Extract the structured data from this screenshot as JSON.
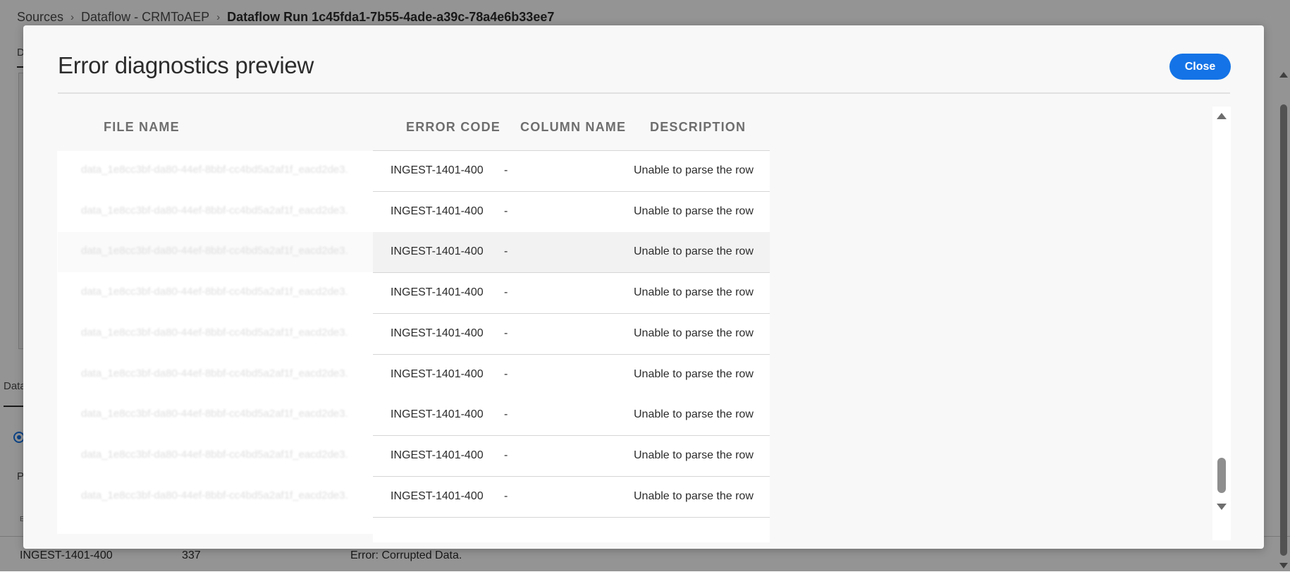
{
  "breadcrumb": {
    "items": [
      "Sources",
      "Dataflow - CRMToAEP"
    ],
    "current": "Dataflow Run 1c45fda1-7b55-4ade-a39c-78a4e6b33ee7",
    "separator": "›"
  },
  "background": {
    "tab_top": "D",
    "tab_bottom": "Data",
    "p_label": "P",
    "e_label": "E",
    "footer": {
      "error_code": "INGEST-1401-400",
      "count": "337",
      "description": "Error: Corrupted Data."
    }
  },
  "modal": {
    "title": "Error diagnostics preview",
    "close_label": "Close",
    "columns": {
      "file_name": "FILE NAME",
      "error_code": "ERROR CODE",
      "column_name": "COLUMN NAME",
      "description": "DESCRIPTION"
    },
    "rows": [
      {
        "file": "data_1e8cc3bf-da80-44ef-8bbf-cc4bd5a2af1f_eacd2de3...",
        "code": "INGEST-1401-400",
        "column": "-",
        "description": "Unable to parse the row"
      },
      {
        "file": "data_1e8cc3bf-da80-44ef-8bbf-cc4bd5a2af1f_eacd2de3...",
        "code": "INGEST-1401-400",
        "column": "-",
        "description": "Unable to parse the row"
      },
      {
        "file": "data_1e8cc3bf-da80-44ef-8bbf-cc4bd5a2af1f_eacd2de3...",
        "code": "INGEST-1401-400",
        "column": "-",
        "description": "Unable to parse the row"
      },
      {
        "file": "data_1e8cc3bf-da80-44ef-8bbf-cc4bd5a2af1f_eacd2de3...",
        "code": "INGEST-1401-400",
        "column": "-",
        "description": "Unable to parse the row"
      },
      {
        "file": "data_1e8cc3bf-da80-44ef-8bbf-cc4bd5a2af1f_eacd2de3...",
        "code": "INGEST-1401-400",
        "column": "-",
        "description": "Unable to parse the row"
      },
      {
        "file": "data_1e8cc3bf-da80-44ef-8bbf-cc4bd5a2af1f_eacd2de3...",
        "code": "INGEST-1401-400",
        "column": "-",
        "description": "Unable to parse the row"
      },
      {
        "file": "data_1e8cc3bf-da80-44ef-8bbf-cc4bd5a2af1f_eacd2de3...",
        "code": "INGEST-1401-400",
        "column": "-",
        "description": "Unable to parse the row"
      },
      {
        "file": "data_1e8cc3bf-da80-44ef-8bbf-cc4bd5a2af1f_eacd2de3...",
        "code": "INGEST-1401-400",
        "column": "-",
        "description": "Unable to parse the row"
      },
      {
        "file": "data_1e8cc3bf-da80-44ef-8bbf-cc4bd5a2af1f_eacd2de3...",
        "code": "INGEST-1401-400",
        "column": "-",
        "description": "Unable to parse the row"
      }
    ]
  },
  "colors": {
    "accent": "#1473e6",
    "overlay": "rgba(0,0,0,0.42)",
    "text": "#2c2c2c",
    "header_text": "#6e6e6e"
  },
  "icons": [
    "chevron-right-icon",
    "scroll-up-arrow-icon",
    "scroll-down-arrow-icon",
    "radio-selected-icon"
  ]
}
